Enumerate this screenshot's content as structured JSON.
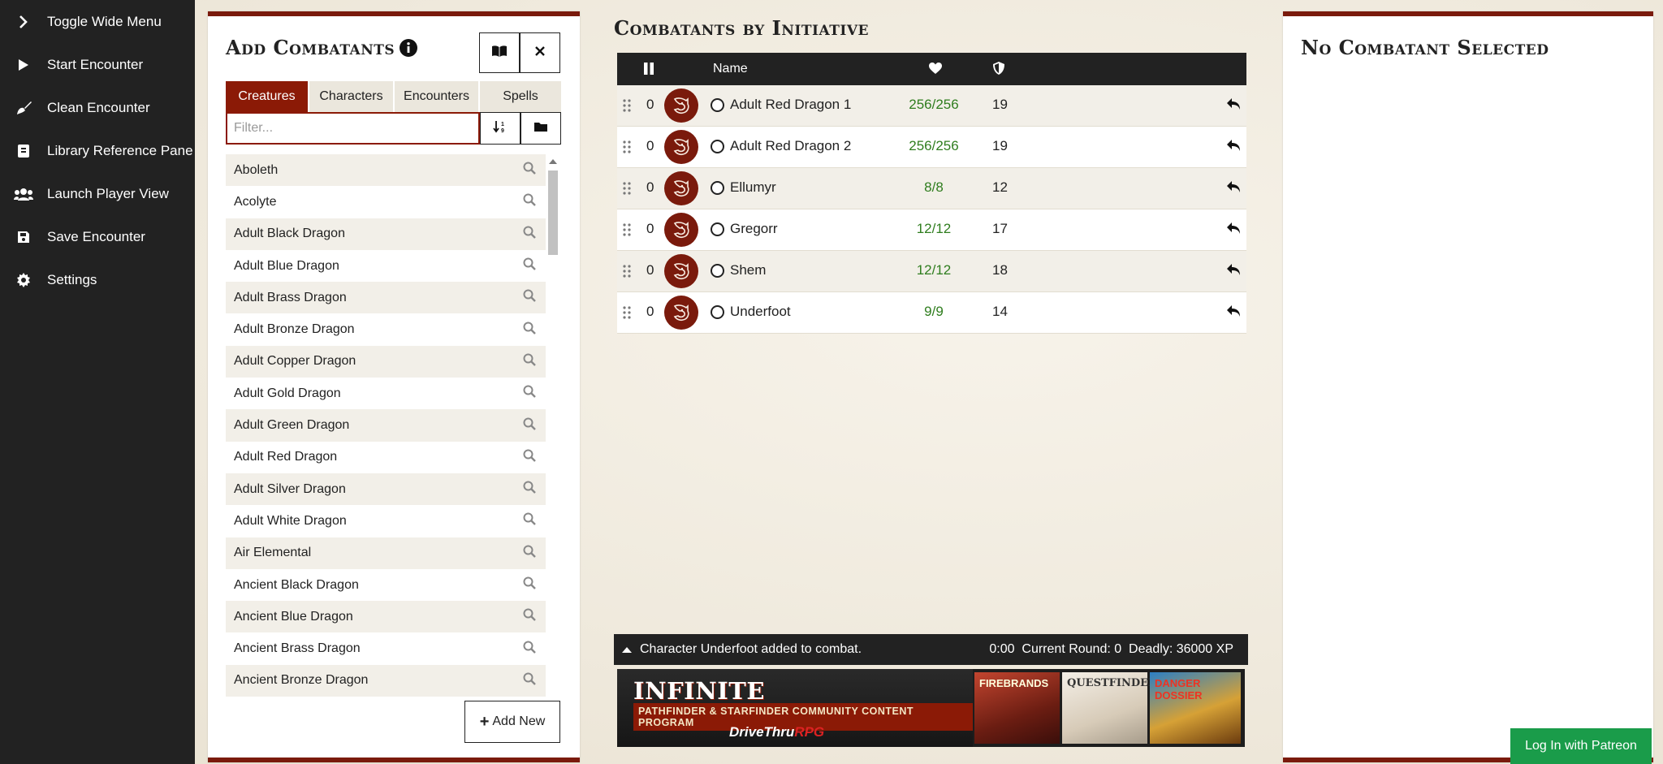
{
  "sidebar": {
    "items": [
      {
        "label": "Toggle Wide Menu",
        "icon": "chevron-right-icon"
      },
      {
        "label": "Start Encounter",
        "icon": "play-icon"
      },
      {
        "label": "Clean Encounter",
        "icon": "broom-icon"
      },
      {
        "label": "Library Reference Pane",
        "icon": "book-icon"
      },
      {
        "label": "Launch Player View",
        "icon": "users-icon"
      },
      {
        "label": "Save Encounter",
        "icon": "save-icon"
      },
      {
        "label": "Settings",
        "icon": "gear-icon"
      }
    ]
  },
  "left_panel": {
    "title": "Add Combatants",
    "tabs": [
      {
        "label": "Creatures",
        "active": true
      },
      {
        "label": "Characters",
        "active": false
      },
      {
        "label": "Encounters",
        "active": false
      },
      {
        "label": "Spells",
        "active": false
      }
    ],
    "filter_placeholder": "Filter...",
    "creatures": [
      "Aboleth",
      "Acolyte",
      "Adult Black Dragon",
      "Adult Blue Dragon",
      "Adult Brass Dragon",
      "Adult Bronze Dragon",
      "Adult Copper Dragon",
      "Adult Gold Dragon",
      "Adult Green Dragon",
      "Adult Red Dragon",
      "Adult Silver Dragon",
      "Adult White Dragon",
      "Air Elemental",
      "Ancient Black Dragon",
      "Ancient Blue Dragon",
      "Ancient Brass Dragon",
      "Ancient Bronze Dragon"
    ],
    "add_new_label": "Add New"
  },
  "center": {
    "title": "Combatants by Initiative",
    "header": {
      "name": "Name"
    },
    "combatants": [
      {
        "init": "0",
        "name": "Adult Red Dragon 1",
        "hp": "256/256",
        "ac": "19"
      },
      {
        "init": "0",
        "name": "Adult Red Dragon 2",
        "hp": "256/256",
        "ac": "19"
      },
      {
        "init": "0",
        "name": "Ellumyr",
        "hp": "8/8",
        "ac": "12"
      },
      {
        "init": "0",
        "name": "Gregorr",
        "hp": "12/12",
        "ac": "17"
      },
      {
        "init": "0",
        "name": "Shem",
        "hp": "12/12",
        "ac": "18"
      },
      {
        "init": "0",
        "name": "Underfoot",
        "hp": "9/9",
        "ac": "14"
      }
    ],
    "status": {
      "message": "Character Underfoot added to combat.",
      "right": "0:00  Current Round: 0  Deadly: 36000 XP"
    },
    "ad": {
      "title": "INFINITE POSSIBILITIES",
      "subtitle": "PATHFINDER & STARFINDER COMMUNITY CONTENT PROGRAM",
      "brand": "DriveThru",
      "brand_suffix": "RPG",
      "covers": [
        "FIREBRANDS",
        "QUESTFINDER",
        "DANGER DOSSIER"
      ]
    }
  },
  "right_panel": {
    "title": "No Combatant Selected"
  },
  "patreon_button": "Log In with Patreon",
  "colors": {
    "accent": "#8b1a06",
    "sidebar": "#222222",
    "hp_green": "#2f7d1e",
    "patreon": "#1a9c4a"
  }
}
